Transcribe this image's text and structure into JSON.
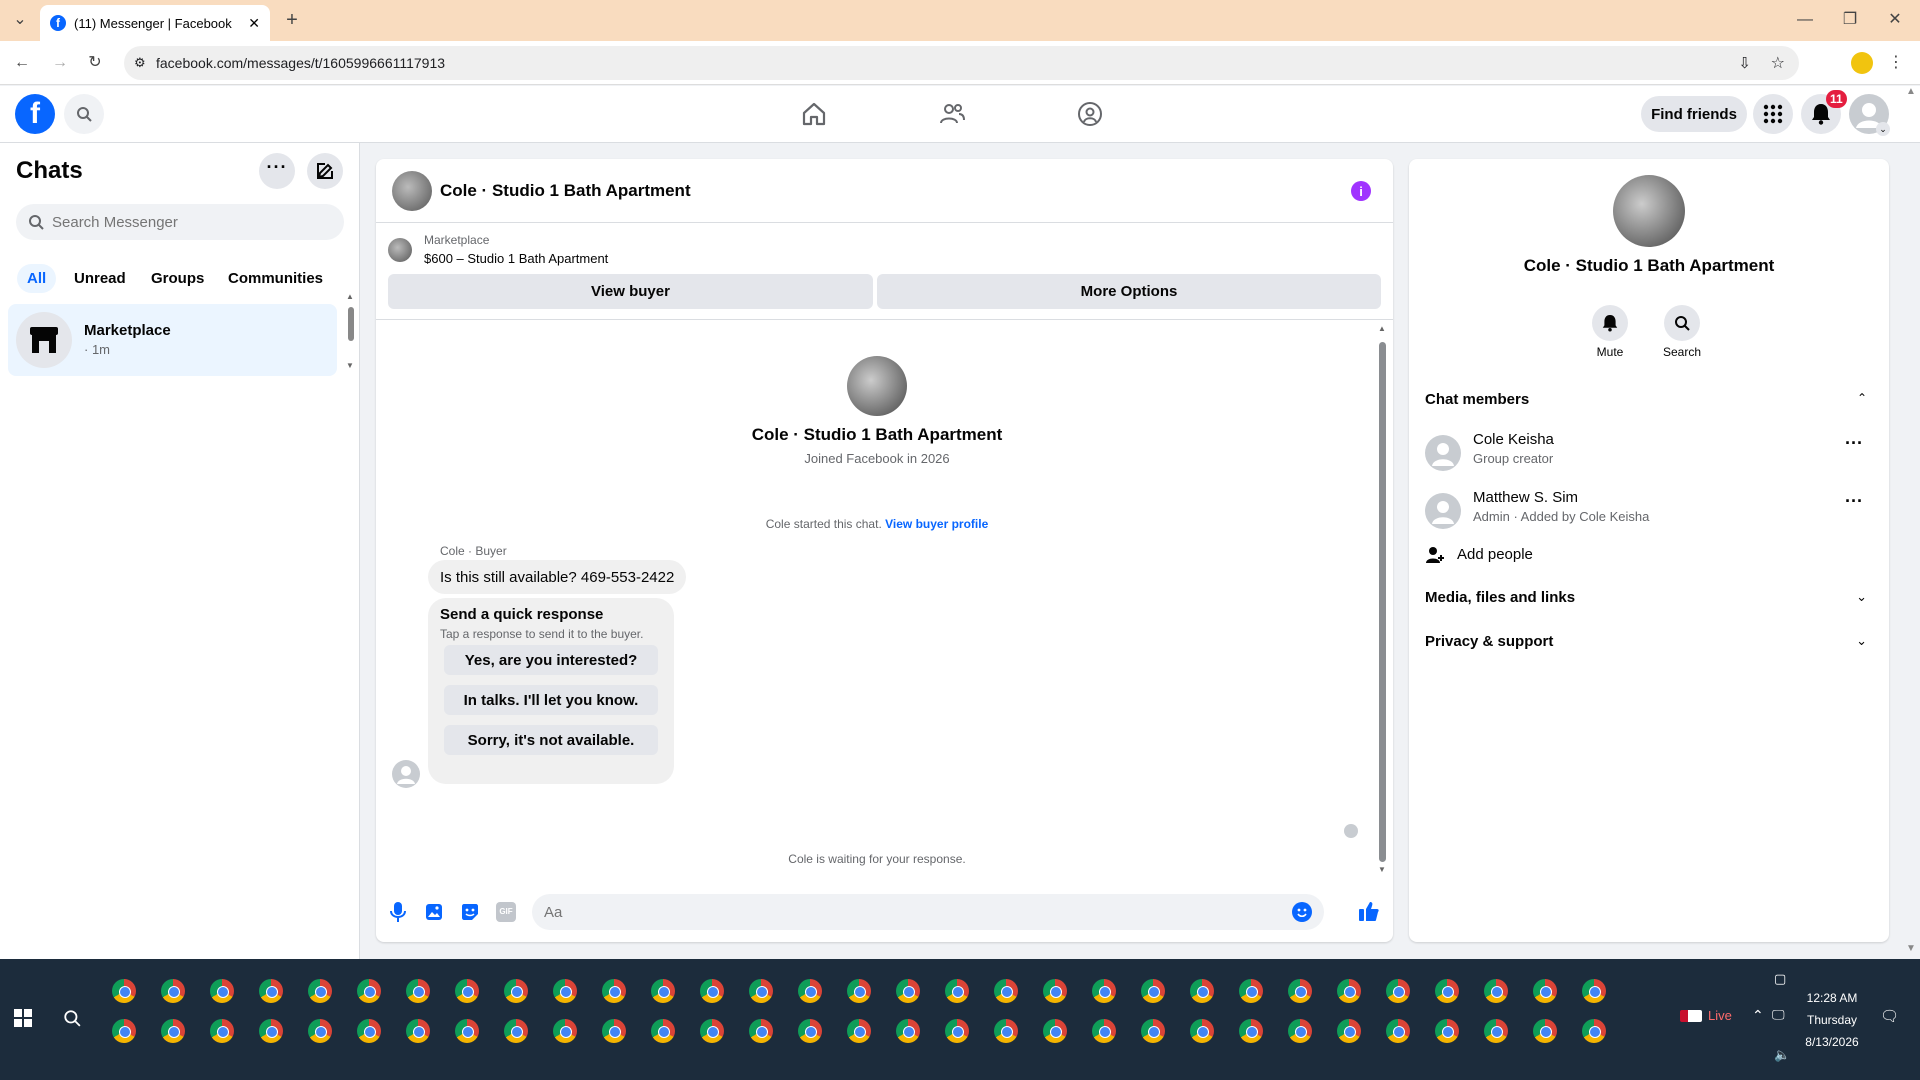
{
  "browser": {
    "tab_title": "(11) Messenger | Facebook",
    "url": "facebook.com/messages/t/1605996661117913"
  },
  "header": {
    "find_friends": "Find friends",
    "notif_count": "11"
  },
  "sidebar": {
    "title": "Chats",
    "search_placeholder": "Search Messenger",
    "filters": [
      "All",
      "Unread",
      "Groups",
      "Communities"
    ],
    "chats": [
      {
        "name": "Marketplace",
        "time": "· 1m"
      }
    ]
  },
  "conversation": {
    "title": "Cole · Studio 1 Bath Apartment",
    "listing_source": "Marketplace",
    "listing": "$600 – Studio 1 Bath Apartment",
    "view_buyer": "View buyer",
    "more_options": "More Options",
    "profile_name": "Cole · Studio 1 Bath Apartment",
    "joined": "Joined Facebook in 2026",
    "started_text": "Cole started this chat.",
    "buyer_profile_link": "View buyer profile",
    "sender_label": "Cole · Buyer",
    "message": "Is this still available? 469-553-2422",
    "quick_title": "Send a quick response",
    "quick_sub": "Tap a response to send it to the buyer.",
    "quick_responses": [
      "Yes, are you interested?",
      "In talks. I'll let you know.",
      "Sorry, it's not available."
    ],
    "waiting": "Cole is waiting for your response.",
    "composer_placeholder": "Aa"
  },
  "details": {
    "name": "Cole · Studio 1 Bath Apartment",
    "mute": "Mute",
    "search": "Search",
    "members_title": "Chat members",
    "members": [
      {
        "name": "Cole Keisha",
        "role": "Group creator"
      },
      {
        "name": "Matthew S. Sim",
        "role": "Admin · Added by Cole Keisha"
      }
    ],
    "add_people": "Add people",
    "media": "Media, files and links",
    "privacy": "Privacy & support"
  },
  "taskbar": {
    "time": "12:28 AM",
    "day": "Thursday",
    "date": "8/13/2026",
    "live": "Live"
  },
  "colors": {
    "fb_blue": "#0866ff",
    "messenger_purple": "#a033ff",
    "notif_red": "#e41e3f"
  }
}
